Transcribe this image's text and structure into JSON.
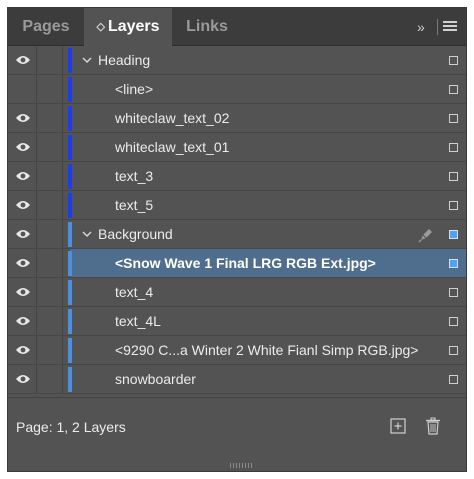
{
  "tabs": {
    "pages": "Pages",
    "layers": "Layers",
    "links": "Links",
    "layers_glyph": "◇",
    "collapse_glyph": "»"
  },
  "colors": {
    "heading_layer": "#1b3ff0",
    "background_layer": "#4a8fe0",
    "selected_row": "#4f6d8c",
    "panel_bg": "#535353",
    "tab_bar_bg": "#3c3c3c"
  },
  "layers": {
    "heading": {
      "name": "Heading",
      "items": [
        "<line>",
        "whiteclaw_text_02",
        "whiteclaw_text_01",
        "text_3",
        "text_5"
      ]
    },
    "background": {
      "name": "Background",
      "items": [
        "<Snow Wave 1 Final LRG RGB Ext.jpg>",
        "text_4",
        "text_4L",
        "<9290 C...a Winter 2 White Fianl Simp RGB.jpg>",
        "snowboarder"
      ],
      "selected_item": "<Snow Wave 1 Final LRG RGB Ext.jpg>"
    }
  },
  "footer": {
    "status": "Page: 1, 2 Layers",
    "icons": [
      "new-layer-icon",
      "trash-icon"
    ]
  }
}
